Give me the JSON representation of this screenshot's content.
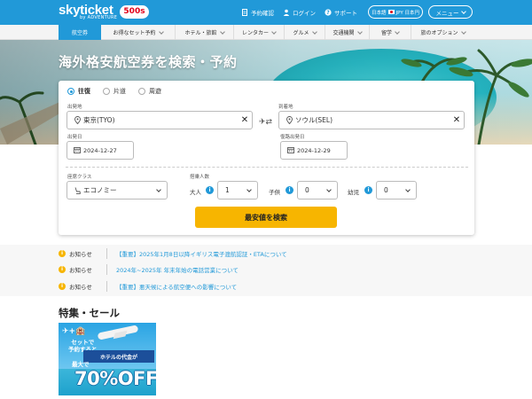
{
  "header": {
    "logo": "skyticket",
    "logo_sub": "by ADVENTURE",
    "badge": "500s",
    "links": [
      {
        "icon": "document-icon",
        "label": "予約確認"
      },
      {
        "icon": "person-icon",
        "label": "ログイン"
      },
      {
        "icon": "question-icon",
        "label": "サポート"
      }
    ],
    "language": "日本語",
    "currency": "JPY 日本円",
    "menu_label": "メニュー"
  },
  "nav": {
    "items": [
      {
        "label": "航空券",
        "active": true,
        "dropdown": false
      },
      {
        "label": "お得なセット予約",
        "active": false,
        "dropdown": true
      },
      {
        "label": "ホテル・旅館",
        "active": false,
        "dropdown": true
      },
      {
        "label": "レンタカー",
        "active": false,
        "dropdown": true
      },
      {
        "label": "グルメ",
        "active": false,
        "dropdown": true
      },
      {
        "label": "交通機関",
        "active": false,
        "dropdown": true
      },
      {
        "label": "留学",
        "active": false,
        "dropdown": true
      },
      {
        "label": "旅のオプション",
        "active": false,
        "dropdown": true
      }
    ]
  },
  "hero": {
    "title": "海外格安航空券を検索・予約"
  },
  "search": {
    "trip_types": [
      {
        "label": "往復",
        "selected": true
      },
      {
        "label": "片道",
        "selected": false
      },
      {
        "label": "周遊",
        "selected": false
      }
    ],
    "origin_label": "出発地",
    "origin_value": "東京(TYO)",
    "destination_label": "到着地",
    "destination_value": "ソウル(SEL)",
    "depart_label": "出発日",
    "depart_value": "2024-12-27",
    "return_label": "復路出発日",
    "return_value": "2024-12-29",
    "class_label": "座席クラス",
    "class_value": "エコノミー",
    "pax_label": "搭乗人数",
    "adult_label": "大人",
    "adult_value": "1",
    "child_label": "子供",
    "child_value": "0",
    "infant_label": "幼児",
    "infant_value": "0",
    "submit_label": "最安値を検索"
  },
  "notices": [
    {
      "label": "お知らせ",
      "text": "【重要】2025年1月8日以降イギリス電子渡航認証・ETAについて"
    },
    {
      "label": "お知らせ",
      "text": "2024年~2025年 年末年始の電話営業について"
    },
    {
      "label": "お知らせ",
      "text": "【重要】悪天候による航空便への影響について"
    }
  ],
  "features": {
    "title": "特集・セール",
    "promo": {
      "line1": "✈+🏨",
      "line2": "セットで\n予約すると",
      "ribbon": "ホテルの代金が",
      "max": "最大で",
      "discount": "70%OFF"
    }
  },
  "colors": {
    "brand_blue": "#2199d8",
    "search_yellow": "#f7b500",
    "notice_yellow": "#f7b500"
  }
}
